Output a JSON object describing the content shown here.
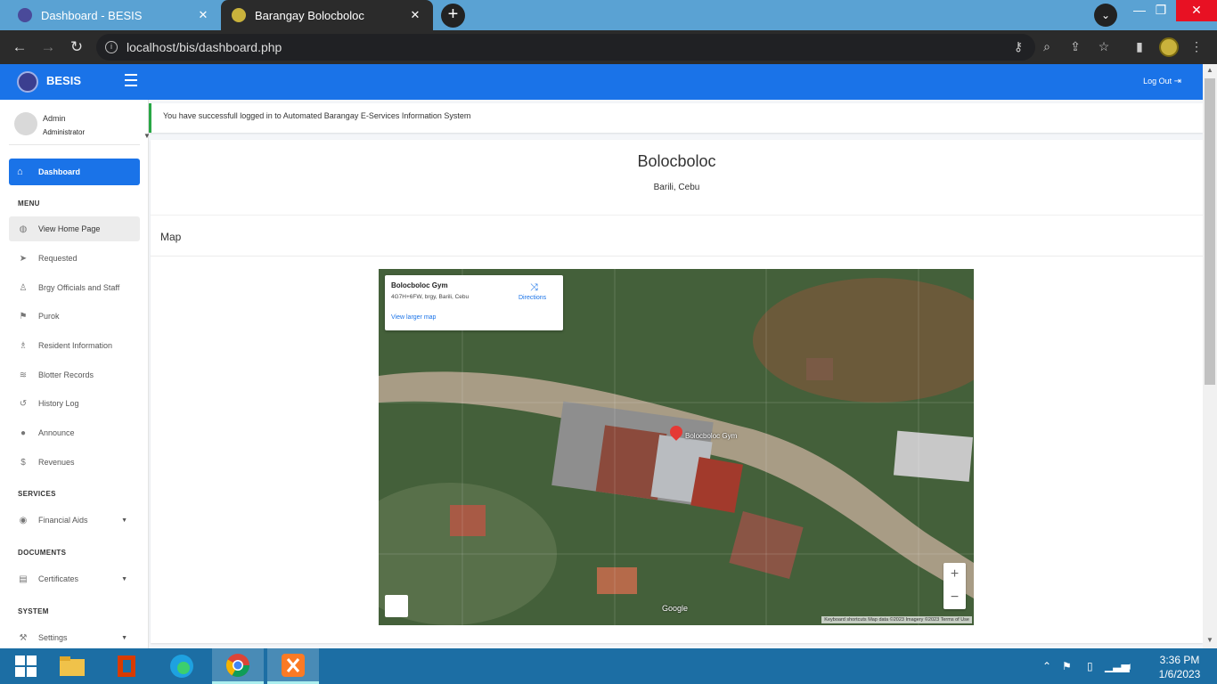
{
  "browser": {
    "tabs": [
      {
        "title": "Dashboard - BESIS",
        "active": false
      },
      {
        "title": "Barangay Bolocboloc",
        "active": true
      }
    ],
    "url": "localhost/bis/dashboard.php"
  },
  "header": {
    "brand": "BESIS",
    "logout_label": "Log Out"
  },
  "sidebar": {
    "user_name": "Admin",
    "user_role": "Administrator",
    "active_item": "Dashboard",
    "sections": {
      "menu": "MENU",
      "services": "SERVICES",
      "documents": "DOCUMENTS",
      "system": "SYSTEM"
    },
    "menu_items": [
      "View Home Page",
      "Requested",
      "Brgy Officials and Staff",
      "Purok",
      "Resident Information",
      "Blotter Records",
      "History Log",
      "Announce",
      "Revenues"
    ],
    "services_items": [
      "Financial Aids"
    ],
    "documents_items": [
      "Certificates"
    ],
    "system_items": [
      "Settings"
    ]
  },
  "main": {
    "alert": "You have successfull logged in to Automated Barangay E-Services Information System",
    "barangay": "Bolocboloc",
    "location": "Barili, Cebu",
    "map_section_title": "Map"
  },
  "map": {
    "place_name": "Bolocboloc Gym",
    "address": "4G7H+6FW, brgy, Barili, Cebu",
    "directions_label": "Directions",
    "larger_map_label": "View larger map",
    "pin_label": "Bolocboloc Gym",
    "provider": "Google",
    "attribution": "Keyboard shortcuts   Map data ©2023 Imagery ©2023   Terms of Use",
    "zoom_in": "+",
    "zoom_out": "−"
  },
  "taskbar": {
    "time": "3:36 PM",
    "date": "1/6/2023"
  },
  "colors": {
    "accent": "#1a73e8",
    "success": "#28a745"
  }
}
